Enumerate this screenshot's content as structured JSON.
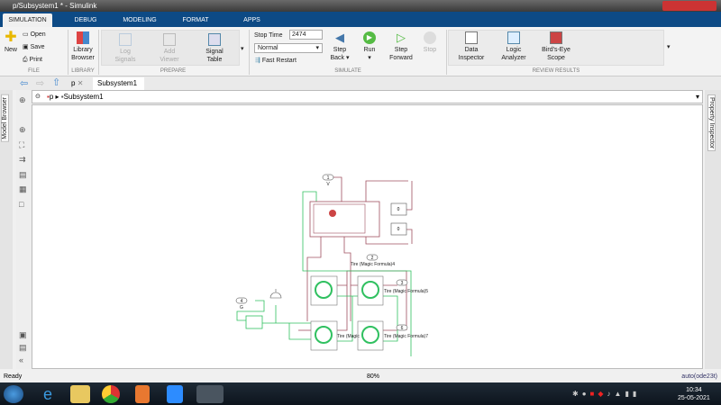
{
  "window": {
    "title": "p/Subsystem1 * - Simulink"
  },
  "tabs": [
    "SIMULATION",
    "DEBUG",
    "MODELING",
    "FORMAT",
    "APPS"
  ],
  "ribbon": {
    "file": {
      "new": "New",
      "open": "Open",
      "save": "Save",
      "print": "Print",
      "group": "FILE"
    },
    "library": {
      "browser": "Library Browser",
      "group": "LIBRARY"
    },
    "prepare": {
      "log": "Log Signals",
      "add": "Add Viewer",
      "signal_table": "Signal Table",
      "group": "PREPARE"
    },
    "simulate": {
      "stop_time_label": "Stop Time",
      "stop_time": "2474",
      "mode": "Normal",
      "fast_restart": "Fast Restart",
      "step_back": "Step Back",
      "run": "Run",
      "step_forward": "Step Forward",
      "stop": "Stop",
      "group": "SIMULATE"
    },
    "review": {
      "data_inspector": "Data Inspector",
      "logic_analyzer": "Logic Analyzer",
      "birds_eye": "Bird's-Eye Scope",
      "group": "REVIEW RESULTS"
    }
  },
  "doc_tabs": [
    "p",
    "Subsystem1"
  ],
  "breadcrumb": [
    "p",
    "Subsystem1"
  ],
  "side": {
    "left": "Model Browser",
    "right": "Property Inspector"
  },
  "diagram": {
    "ports": [
      {
        "num": "1",
        "label": "V"
      },
      {
        "num": "2",
        "label": "Tire (Magic Formula)4"
      },
      {
        "num": "3",
        "label": "Tire (Magic Formula)5"
      },
      {
        "num": "4",
        "label": "G"
      },
      {
        "num": "6",
        "label": "Tire (Magic Formula)7"
      }
    ],
    "constants": [
      "0",
      "0"
    ],
    "tire_label_partial": "Tire (Magic"
  },
  "status": {
    "left": "Ready",
    "zoom": "80%",
    "solver": "auto(ode23t)"
  },
  "clock": {
    "time": "10:34",
    "date": "25-05-2021"
  },
  "colors": {
    "tabbar": "#0d4a85",
    "mech": "#a05060",
    "hyd": "#30c060"
  }
}
